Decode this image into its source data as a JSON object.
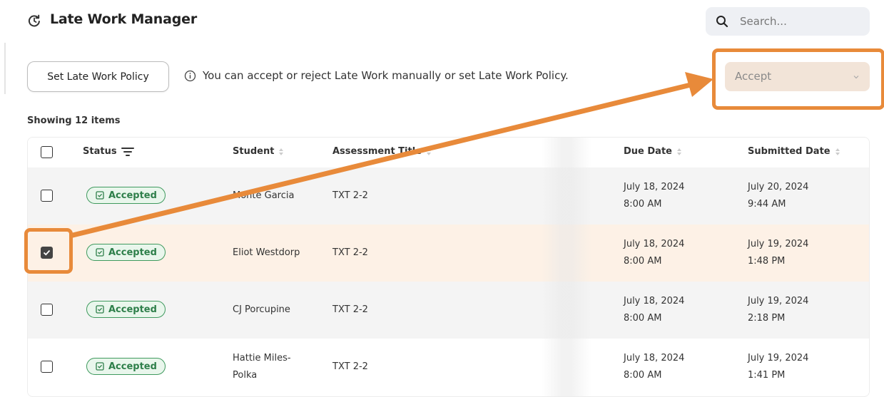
{
  "header": {
    "title": "Late Work Manager",
    "title_icon": "clock-rotate-icon",
    "search_placeholder": "Search..."
  },
  "toolbar": {
    "policy_button": "Set Late Work Policy",
    "info_text": "You can accept or reject Late Work manually or set Late Work Policy.",
    "action_dropdown": "Accept"
  },
  "count_text": "Showing 12 items",
  "table": {
    "columns": {
      "status": "Status",
      "student": "Student",
      "assessment": "Assessment Title",
      "due": "Due Date",
      "submitted": "Submitted Date"
    },
    "rows": [
      {
        "checked": false,
        "status": "Accepted",
        "student": "Monte Garcia",
        "student2": "",
        "assessment": "TXT 2-2",
        "due_date": "July 18, 2024",
        "due_time": "8:00 AM",
        "sub_date": "July 20, 2024",
        "sub_time": "9:44 AM"
      },
      {
        "checked": true,
        "status": "Accepted",
        "student": "Eliot Westdorp",
        "student2": "",
        "assessment": "TXT 2-2",
        "due_date": "July 18, 2024",
        "due_time": "8:00 AM",
        "sub_date": "July 19, 2024",
        "sub_time": "1:48 PM"
      },
      {
        "checked": false,
        "status": "Accepted",
        "student": "CJ Porcupine",
        "student2": "",
        "assessment": "TXT 2-2",
        "due_date": "July 18, 2024",
        "due_time": "8:00 AM",
        "sub_date": "July 19, 2024",
        "sub_time": "2:18 PM"
      },
      {
        "checked": false,
        "status": "Accepted",
        "student": "Hattie Miles-",
        "student2": "Polka",
        "assessment": "TXT 2-2",
        "due_date": "July 18, 2024",
        "due_time": "8:00 AM",
        "sub_date": "July 19, 2024",
        "sub_time": "1:41 PM"
      }
    ]
  },
  "colors": {
    "annotation": "#e88a3a",
    "badge_green": "#2e7f4a",
    "selected_row": "#fdf1e6"
  }
}
